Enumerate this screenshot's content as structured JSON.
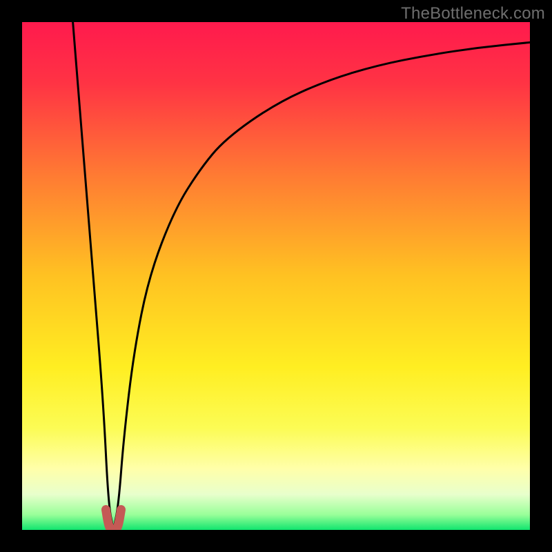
{
  "watermark": "TheBottleneck.com",
  "chart_data": {
    "type": "line",
    "title": "",
    "xlabel": "",
    "ylabel": "",
    "xlim": [
      0,
      100
    ],
    "ylim": [
      0,
      100
    ],
    "grid": false,
    "legend": false,
    "bottleneck_x": 18,
    "series": [
      {
        "name": "left-branch",
        "x": [
          10,
          12,
          14,
          16,
          17,
          18
        ],
        "values": [
          100,
          75,
          50,
          25,
          5,
          0
        ]
      },
      {
        "name": "right-branch",
        "x": [
          18,
          19,
          20,
          22,
          25,
          30,
          35,
          40,
          50,
          60,
          70,
          80,
          90,
          100
        ],
        "values": [
          0,
          5,
          18,
          35,
          50,
          63,
          71,
          77,
          84,
          88.5,
          91.5,
          93.5,
          95,
          96
        ]
      },
      {
        "name": "bottleneck-marker",
        "x": [
          16.5,
          17,
          17.5,
          18,
          18.5,
          19,
          19.5
        ],
        "values": [
          4,
          1,
          0,
          0,
          0,
          1,
          4
        ]
      }
    ],
    "gradient_stops": [
      {
        "offset": 0.0,
        "color": "#ff1a4d"
      },
      {
        "offset": 0.12,
        "color": "#ff3344"
      },
      {
        "offset": 0.3,
        "color": "#ff7a33"
      },
      {
        "offset": 0.5,
        "color": "#ffc222"
      },
      {
        "offset": 0.68,
        "color": "#ffee22"
      },
      {
        "offset": 0.8,
        "color": "#fcfc55"
      },
      {
        "offset": 0.88,
        "color": "#ffffaa"
      },
      {
        "offset": 0.93,
        "color": "#e8ffcc"
      },
      {
        "offset": 0.97,
        "color": "#99ff99"
      },
      {
        "offset": 1.0,
        "color": "#11e56e"
      }
    ],
    "marker_color": "#c45a55"
  }
}
